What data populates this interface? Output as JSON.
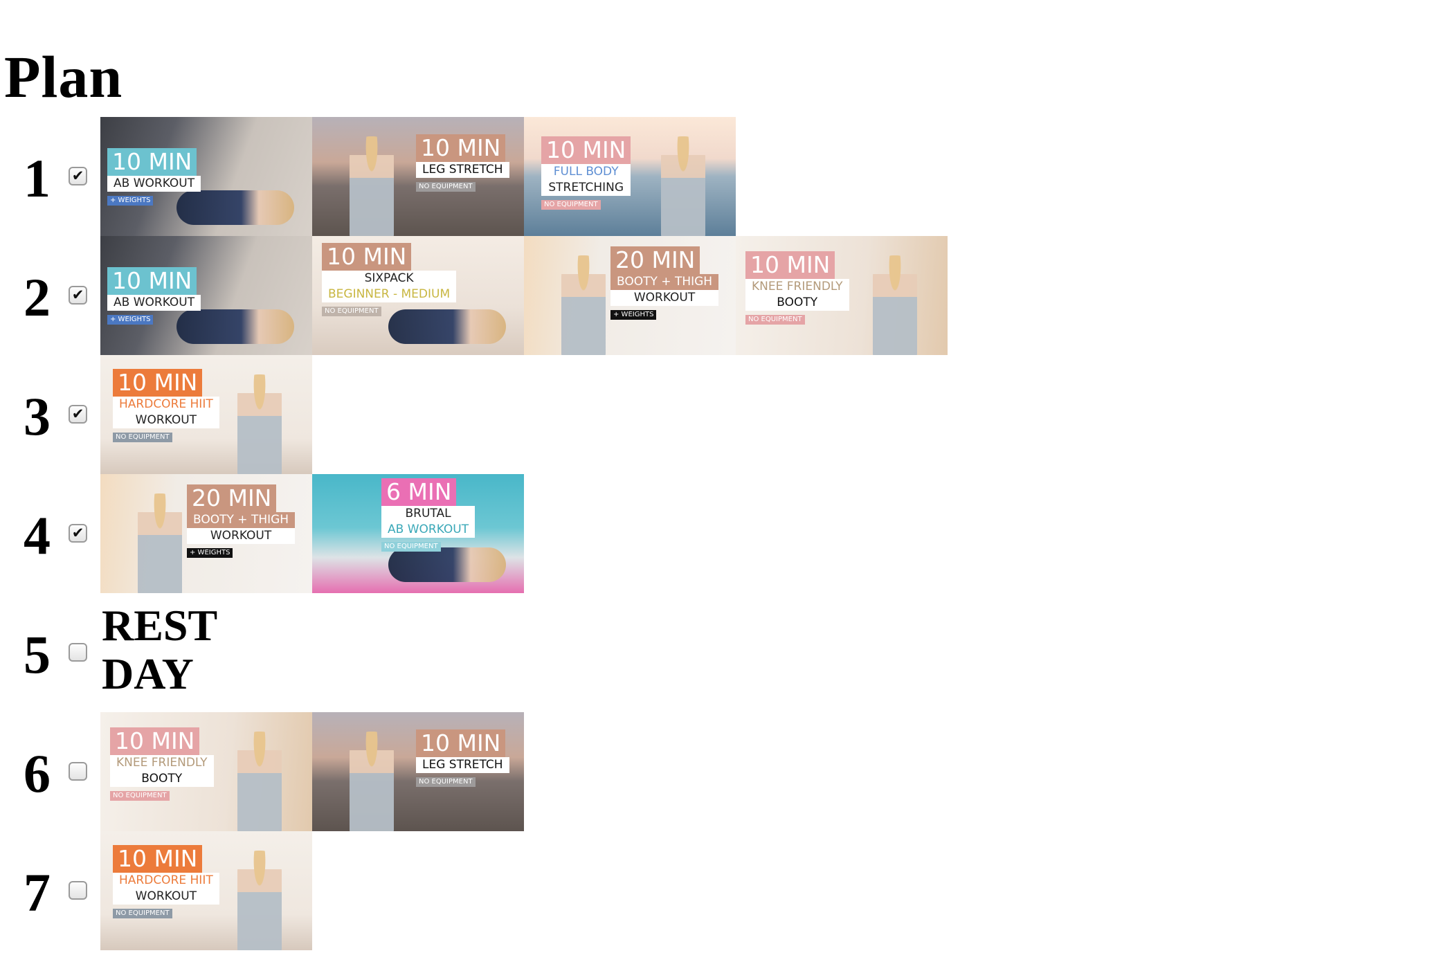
{
  "page": {
    "title": "Plan"
  },
  "colors": {
    "teal": "#6cc2cf",
    "rose": "#d89a98",
    "tan": "#c9967f",
    "orange": "#ec7b3b",
    "pink": "#ea6fb4",
    "blue_label": "#5f8fd3",
    "gold_label": "#c8b640",
    "weights_tag": "#4b78c2"
  },
  "days": [
    {
      "number": "1",
      "checked": true,
      "videos": [
        {
          "icon": "ab-workout-thumbnail",
          "time": "10 MIN",
          "lines": [
            "AB WORKOUT"
          ],
          "tag": "+ WEIGHTS"
        },
        {
          "icon": "leg-stretch-thumbnail",
          "time": "10 MIN",
          "lines": [
            "LEG STRETCH"
          ],
          "tag": "NO EQUIPMENT"
        },
        {
          "icon": "full-body-stretching-thumbnail",
          "time": "10 MIN",
          "lines": [
            "FULL BODY",
            "STRETCHING"
          ],
          "tag": "NO EQUIPMENT"
        }
      ]
    },
    {
      "number": "2",
      "checked": true,
      "videos": [
        {
          "icon": "ab-workout-thumbnail",
          "time": "10 MIN",
          "lines": [
            "AB WORKOUT"
          ],
          "tag": "+ WEIGHTS"
        },
        {
          "icon": "sixpack-thumbnail",
          "time": "10 MIN",
          "lines": [
            "SIXPACK",
            "BEGINNER - MEDIUM"
          ],
          "tag": "NO EQUIPMENT"
        },
        {
          "icon": "booty-thigh-thumbnail",
          "time": "20 MIN",
          "lines": [
            "BOOTY + THIGH",
            "WORKOUT"
          ],
          "tag": "+ WEIGHTS"
        },
        {
          "icon": "knee-friendly-booty-thumbnail",
          "time": "10 MIN",
          "lines": [
            "KNEE FRIENDLY",
            "BOOTY"
          ],
          "tag": "NO EQUIPMENT"
        }
      ]
    },
    {
      "number": "3",
      "checked": true,
      "videos": [
        {
          "icon": "hardcore-hiit-thumbnail",
          "time": "10 MIN",
          "lines": [
            "HARDCORE HIIT",
            "WORKOUT"
          ],
          "tag": "NO EQUIPMENT"
        }
      ]
    },
    {
      "number": "4",
      "checked": true,
      "videos": [
        {
          "icon": "booty-thigh-thumbnail",
          "time": "20 MIN",
          "lines": [
            "BOOTY + THIGH",
            "WORKOUT"
          ],
          "tag": "+ WEIGHTS"
        },
        {
          "icon": "brutal-ab-workout-thumbnail",
          "time": "6 MIN",
          "lines": [
            "BRUTAL",
            "AB WORKOUT"
          ],
          "tag": "NO EQUIPMENT"
        }
      ]
    },
    {
      "number": "5",
      "checked": false,
      "rest_label": "REST DAY",
      "videos": []
    },
    {
      "number": "6",
      "checked": false,
      "videos": [
        {
          "icon": "knee-friendly-booty-thumbnail",
          "time": "10 MIN",
          "lines": [
            "KNEE FRIENDLY",
            "BOOTY"
          ],
          "tag": "NO EQUIPMENT"
        },
        {
          "icon": "leg-stretch-thumbnail",
          "time": "10 MIN",
          "lines": [
            "LEG STRETCH"
          ],
          "tag": "NO EQUIPMENT"
        }
      ]
    },
    {
      "number": "7",
      "checked": false,
      "videos": [
        {
          "icon": "hardcore-hiit-thumbnail",
          "time": "10 MIN",
          "lines": [
            "HARDCORE HIIT",
            "WORKOUT"
          ],
          "tag": "NO EQUIPMENT"
        }
      ]
    }
  ],
  "check_glyph": "✔"
}
